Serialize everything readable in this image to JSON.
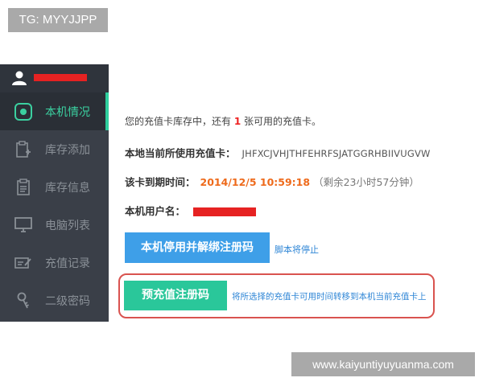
{
  "watermarks": {
    "top_left": "TG: MYYJJPP",
    "bottom_right": "www.kaiyuntiyuyuanma.com"
  },
  "sidebar": {
    "items": [
      {
        "label": "本机情况",
        "icon": "machine-status-icon",
        "active": true
      },
      {
        "label": "库存添加",
        "icon": "stock-add-icon",
        "active": false
      },
      {
        "label": "库存信息",
        "icon": "stock-info-icon",
        "active": false
      },
      {
        "label": "电脑列表",
        "icon": "monitor-icon",
        "active": false
      },
      {
        "label": "充值记录",
        "icon": "recharge-record-icon",
        "active": false
      },
      {
        "label": "二级密码",
        "icon": "key-icon",
        "active": false
      }
    ]
  },
  "main": {
    "stock": {
      "prefix": "您的充值卡库存中，还有",
      "count": "1",
      "suffix": "张可用的充值卡。"
    },
    "card_in_use": {
      "label": "本地当前所使用充值卡：",
      "value": "JHFXCJVHJTHFEHRFSJATGGRHBIIVUGVW"
    },
    "expiry": {
      "label": "该卡到期时间：",
      "value": "2014/12/5 10:59:18",
      "remaining": "（剩余23小时57分钟）"
    },
    "username": {
      "label": "本机用户名："
    },
    "unbind_button": "本机停用并解绑注册码",
    "unbind_note": "脚本将停止",
    "prepay_button": "预充值注册码",
    "prepay_note": "将所选择的充值卡可用时间转移到本机当前充值卡上"
  },
  "colors": {
    "sidebar_bg": "#3a3f48",
    "accent_green": "#2ac79a",
    "accent_blue": "#3e9fe8",
    "expiry_orange": "#ee6a1b",
    "redaction_red": "#e62222",
    "highlight_border": "#d9534f"
  }
}
